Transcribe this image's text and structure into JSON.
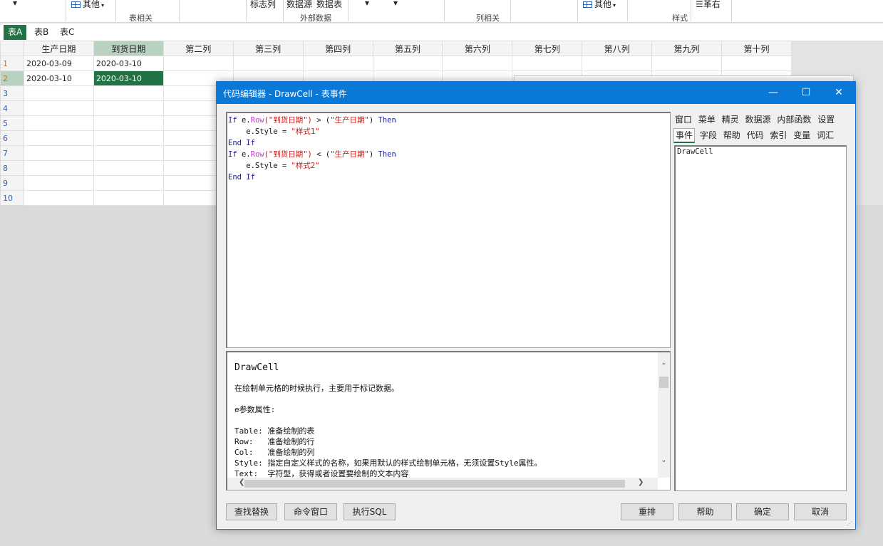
{
  "ribbon": {
    "items": [
      "其他",
      "标志列",
      "数据源",
      "数据表",
      "其他",
      "革右"
    ],
    "groups": [
      "表相关",
      "外部数据",
      "列相关",
      "样式"
    ]
  },
  "sheet_tabs": [
    "表A",
    "表B",
    "表C"
  ],
  "grid": {
    "columns": [
      "生产日期",
      "到货日期",
      "第二列",
      "第三列",
      "第四列",
      "第五列",
      "第六列",
      "第七列",
      "第八列",
      "第九列",
      "第十列"
    ],
    "rows": [
      {
        "num": "1",
        "cells": [
          "2020-03-09",
          "2020-03-10"
        ]
      },
      {
        "num": "2",
        "cells": [
          "2020-03-10",
          "2020-03-10"
        ]
      },
      {
        "num": "3",
        "cells": []
      },
      {
        "num": "4",
        "cells": []
      },
      {
        "num": "5",
        "cells": []
      },
      {
        "num": "6",
        "cells": []
      },
      {
        "num": "7",
        "cells": []
      },
      {
        "num": "8",
        "cells": []
      },
      {
        "num": "9",
        "cells": []
      },
      {
        "num": "10",
        "cells": []
      }
    ]
  },
  "dialog": {
    "title": "代码编辑器 - DrawCell - 表事件",
    "minimize_glyph": "—",
    "maximize_glyph": "☐",
    "close_glyph": "✕",
    "code": {
      "l1": {
        "kw1": "If",
        "obj": " e.",
        "fn": "Row",
        "s1": "(\"到货日期\")",
        "op": " > (",
        "s2": "\"生产日期\"",
        "close": ") ",
        "kw2": "Then"
      },
      "l2": {
        "indent": "    e.Style = ",
        "str": "\"样式1\""
      },
      "l3": {
        "kw": "End If"
      },
      "l4": {
        "kw1": "If",
        "obj": " e.",
        "fn": "Row",
        "s1": "(\"到货日期\")",
        "op": " < (",
        "s2": "\"生产日期\"",
        "close": ") ",
        "kw2": "Then"
      },
      "l5": {
        "indent": "    e.Style = ",
        "str": "\"样式2\""
      },
      "l6": {
        "kw": "End If"
      }
    },
    "help": {
      "title": "DrawCell",
      "desc": "在绘制单元格的时候执行，主要用于标记数据。",
      "params_title": "e参数属性:",
      "props": [
        "Table: 准备绘制的表",
        "Row:   准备绘制的行",
        "Col:   准备绘制的列",
        "Style: 指定自定义样式的名称，如果用默认的样式绘制单元格，无须设置Style属性。",
        "Text:  字符型，获得或者设置要绘制的文本内容"
      ]
    },
    "side_tabs_row1": [
      "窗口",
      "菜单",
      "精灵",
      "数据源",
      "内部函数",
      "设置"
    ],
    "side_tabs_row2": [
      "事件",
      "字段",
      "帮助",
      "代码",
      "索引",
      "变量",
      "词汇"
    ],
    "side_list": [
      "DrawCell"
    ],
    "buttons_left": [
      "查找替换",
      "命令窗口",
      "执行SQL"
    ],
    "buttons_right": [
      "重排",
      "帮助",
      "确定",
      "取消"
    ]
  }
}
